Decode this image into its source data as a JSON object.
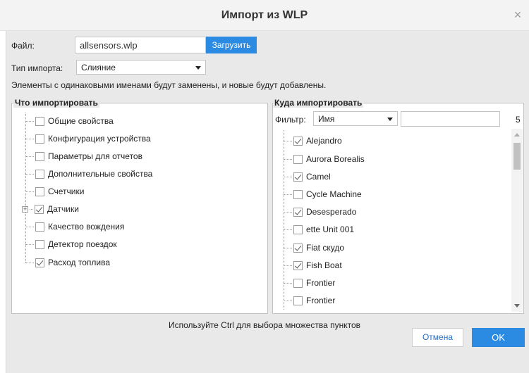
{
  "dialog": {
    "title": "Импорт из WLP",
    "close_icon": "close-icon"
  },
  "file": {
    "label": "Файл:",
    "value": "allsensors.wlp",
    "upload_label": "Загрузить"
  },
  "import_type": {
    "label": "Тип импорта:",
    "selected": "Слияние"
  },
  "info_text": "Элементы с одинаковыми именами будут заменены, и новые будут добавлены.",
  "what_group": {
    "title": "Что импортировать",
    "items": [
      {
        "label": "Общие свойства",
        "checked": false
      },
      {
        "label": "Конфигурация устройства",
        "checked": false
      },
      {
        "label": "Параметры для отчетов",
        "checked": false
      },
      {
        "label": "Дополнительные свойства",
        "checked": false
      },
      {
        "label": "Счетчики",
        "checked": false
      },
      {
        "label": "Датчики",
        "checked": true,
        "expandable": true
      },
      {
        "label": "Качество вождения",
        "checked": false
      },
      {
        "label": "Детектор поездок",
        "checked": false
      },
      {
        "label": "Расход топлива",
        "checked": true
      }
    ]
  },
  "where_group": {
    "title": "Куда импортировать",
    "filter_label": "Фильтр:",
    "filter_selected": "Имя",
    "filter_value": "",
    "count": "5",
    "items": [
      {
        "label": "Alejandro",
        "checked": true
      },
      {
        "label": "Aurora Borealis",
        "checked": false
      },
      {
        "label": "Camel",
        "checked": true
      },
      {
        "label": "Cycle Machine",
        "checked": false
      },
      {
        "label": "Desesperado",
        "checked": true
      },
      {
        "label": "ette Unit 001",
        "checked": false
      },
      {
        "label": "Fiat скудо",
        "checked": true
      },
      {
        "label": "Fish Boat",
        "checked": true
      },
      {
        "label": "Frontier",
        "checked": false
      },
      {
        "label": "Frontier",
        "checked": false
      }
    ]
  },
  "hint": "Используйте Ctrl для выбора множества пунктов",
  "buttons": {
    "cancel": "Отмена",
    "ok": "OK"
  },
  "colors": {
    "accent": "#2b8be3",
    "body_bg": "#e9e9e9"
  }
}
